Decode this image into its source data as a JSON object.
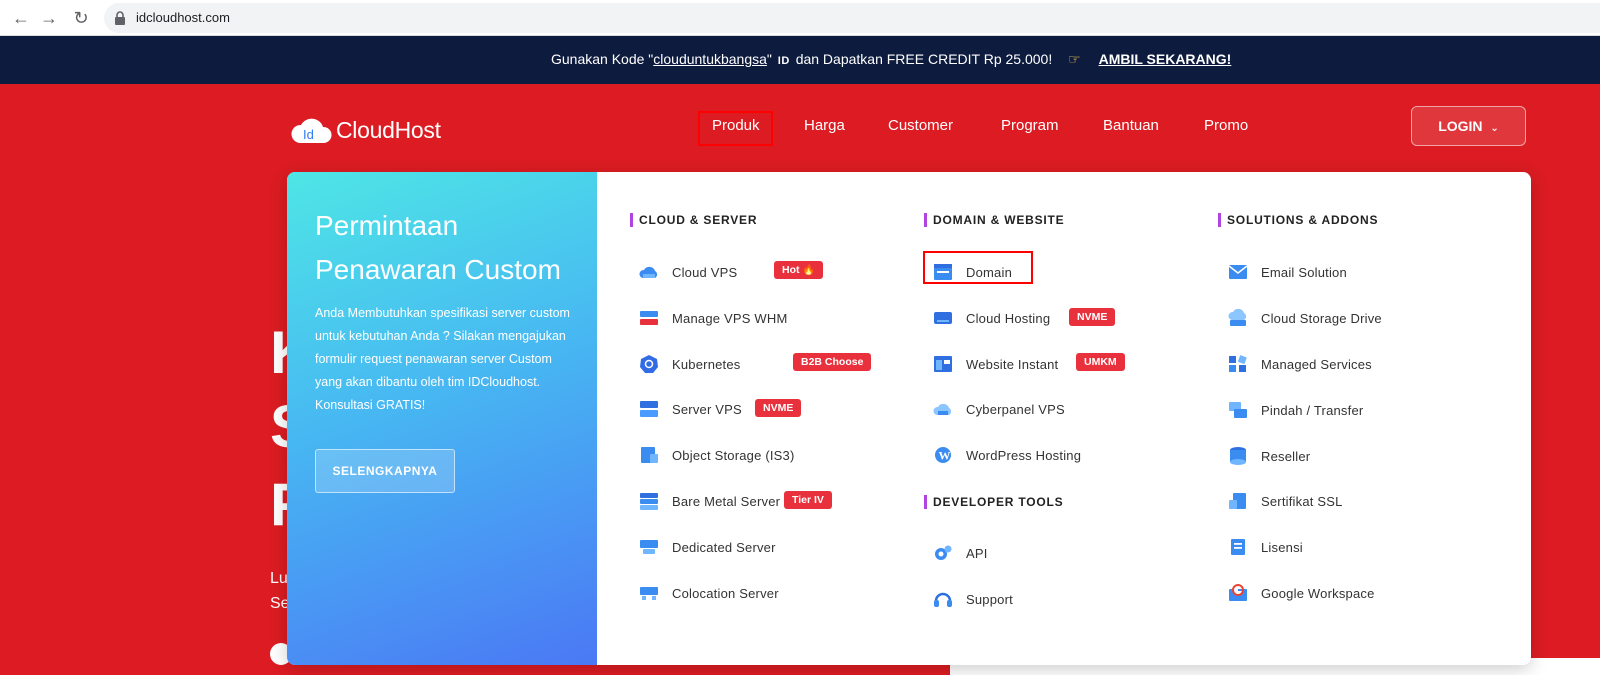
{
  "browser": {
    "url": "idcloudhost.com"
  },
  "promo": {
    "text_before": "Gunakan Kode \"",
    "code": "clouduntukbangsa",
    "text_mid": "\"",
    "id_mark": "ID",
    "text_after": "dan Dapatkan FREE CREDIT Rp 25.000!",
    "cta": "AMBIL SEKARANG!"
  },
  "header": {
    "logo_text": "CloudHost",
    "logo_badge": "Id",
    "nav": [
      "Produk",
      "Harga",
      "Customer",
      "Program",
      "Bantuan",
      "Promo"
    ],
    "login_label": "LOGIN"
  },
  "hero": {
    "letters": [
      "K",
      "S",
      "F"
    ],
    "small_lines": [
      "Lu",
      "Se"
    ]
  },
  "dropdown": {
    "promo_title": "Permintaan Penawaran Custom",
    "promo_desc": "Anda Membutuhkan spesifikasi server custom untuk kebutuhan Anda ? Silakan mengajukan formulir request penawaran server Custom yang akan dibantu oleh tim IDCloudhost. Konsultasi GRATIS!",
    "promo_button": "SELENGKAPNYA",
    "cloud_server": {
      "heading": "CLOUD & SERVER",
      "items": [
        {
          "label": "Cloud VPS",
          "badge": "Hot 🔥"
        },
        {
          "label": "Manage VPS WHM",
          "badge": ""
        },
        {
          "label": "Kubernetes",
          "badge": "B2B Choose"
        },
        {
          "label": "Server VPS",
          "badge": "NVME"
        },
        {
          "label": "Object Storage (IS3)",
          "badge": ""
        },
        {
          "label": "Bare Metal Server",
          "badge": "Tier IV"
        },
        {
          "label": "Dedicated Server",
          "badge": ""
        },
        {
          "label": "Colocation Server",
          "badge": ""
        }
      ]
    },
    "domain_website": {
      "heading": "DOMAIN & WEBSITE",
      "items": [
        {
          "label": "Domain",
          "badge": ""
        },
        {
          "label": "Cloud Hosting",
          "badge": "NVME"
        },
        {
          "label": "Website Instant",
          "badge": "UMKM"
        },
        {
          "label": "Cyberpanel VPS",
          "badge": ""
        },
        {
          "label": "WordPress Hosting",
          "badge": ""
        }
      ]
    },
    "developer_tools": {
      "heading": "DEVELOPER TOOLS",
      "items": [
        {
          "label": "API"
        },
        {
          "label": "Support"
        }
      ]
    },
    "solutions": {
      "heading": "SOLUTIONS & ADDONS",
      "items": [
        {
          "label": "Email Solution"
        },
        {
          "label": "Cloud Storage Drive"
        },
        {
          "label": "Managed Services"
        },
        {
          "label": "Pindah / Transfer"
        },
        {
          "label": "Reseller"
        },
        {
          "label": "Sertifikat SSL"
        },
        {
          "label": "Lisensi"
        },
        {
          "label": "Google Workspace"
        }
      ]
    }
  },
  "colors": {
    "brand_red": "#dc1c22",
    "banner_navy": "#0d1b3e",
    "badge_red": "#e8313c",
    "heading_accent": "#b144e0",
    "highlight_box": "#ff0000"
  }
}
